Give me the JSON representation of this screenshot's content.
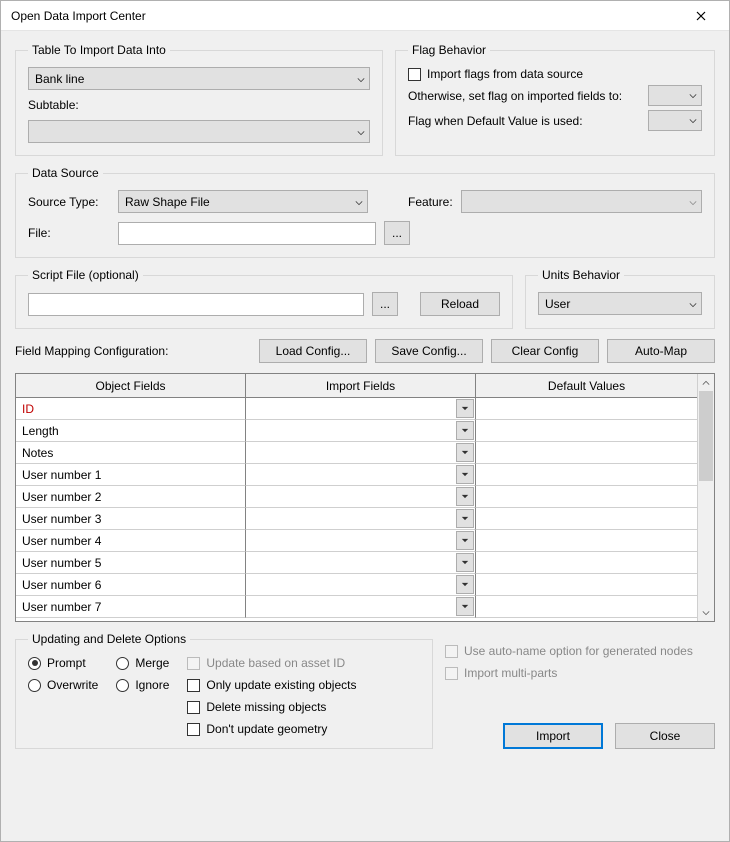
{
  "window": {
    "title": "Open Data Import Center"
  },
  "tableBox": {
    "legend": "Table To Import Data Into",
    "table_value": "Bank line",
    "subtable_label": "Subtable:",
    "subtable_value": ""
  },
  "flagBox": {
    "legend": "Flag Behavior",
    "import_flags_label": "Import flags from data source",
    "otherwise_label": "Otherwise, set flag on imported fields to:",
    "default_used_label": "Flag when Default Value is used:"
  },
  "dataSource": {
    "legend": "Data Source",
    "source_type_label": "Source Type:",
    "source_type_value": "Raw Shape File",
    "feature_label": "Feature:",
    "feature_value": "",
    "file_label": "File:",
    "file_value": "",
    "browse_label": "..."
  },
  "script": {
    "legend": "Script File (optional)",
    "value": "",
    "browse_label": "...",
    "reload_label": "Reload"
  },
  "units": {
    "legend": "Units Behavior",
    "value": "User"
  },
  "mapping": {
    "label": "Field Mapping Configuration:",
    "load_label": "Load Config...",
    "save_label": "Save Config...",
    "clear_label": "Clear Config",
    "automap_label": "Auto-Map",
    "headers": {
      "object": "Object Fields",
      "import": "Import Fields",
      "default": "Default Values"
    },
    "rows": [
      {
        "object": "ID",
        "red": true
      },
      {
        "object": "Length"
      },
      {
        "object": "Notes"
      },
      {
        "object": "User number 1"
      },
      {
        "object": "User number 2"
      },
      {
        "object": "User number 3"
      },
      {
        "object": "User number 4"
      },
      {
        "object": "User number 5"
      },
      {
        "object": "User number 6"
      },
      {
        "object": "User number 7"
      }
    ]
  },
  "update": {
    "legend": "Updating and Delete Options",
    "prompt": "Prompt",
    "merge": "Merge",
    "overwrite": "Overwrite",
    "ignore": "Ignore",
    "asset_id": "Update based on asset ID",
    "only_existing": "Only update existing objects",
    "delete_missing": "Delete missing objects",
    "no_geom": "Don't update geometry"
  },
  "rightOpts": {
    "autoname": "Use auto-name option for generated nodes",
    "multiparts": "Import multi-parts"
  },
  "actions": {
    "import": "Import",
    "close": "Close"
  }
}
